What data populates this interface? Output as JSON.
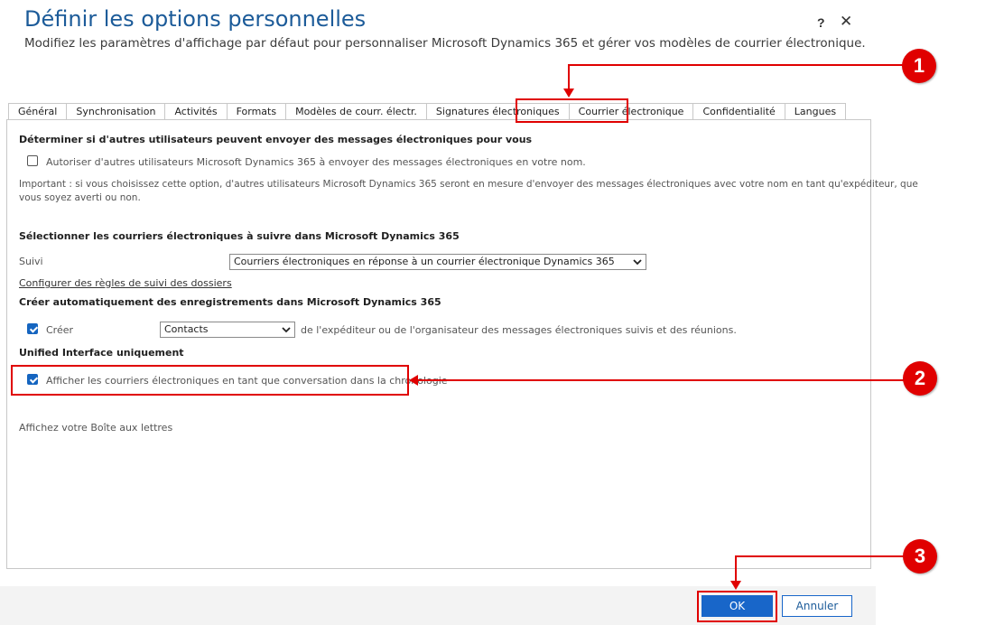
{
  "header": {
    "title": "Définir les options personnelles",
    "subtitle": "Modifiez les paramètres d'affichage par défaut pour personnaliser Microsoft Dynamics 365 et gérer vos modèles de courrier électronique.",
    "help": "?",
    "close": "✕"
  },
  "tabs": [
    {
      "label": "Général"
    },
    {
      "label": "Synchronisation"
    },
    {
      "label": "Activités"
    },
    {
      "label": "Formats"
    },
    {
      "label": "Modèles de courr. électr."
    },
    {
      "label": "Signatures électroniques"
    },
    {
      "label": "Courrier électronique",
      "active": true
    },
    {
      "label": "Confidentialité"
    },
    {
      "label": "Langues"
    }
  ],
  "email": {
    "section1_title": "Déterminer si d'autres utilisateurs peuvent envoyer des messages électroniques pour vous",
    "allow_others_label": "Autoriser d'autres utilisateurs Microsoft Dynamics 365 à envoyer des messages électroniques en votre nom.",
    "allow_others_checked": false,
    "important_line1": "Important : si vous choisissez cette option, d'autres utilisateurs Microsoft Dynamics 365 seront en mesure d'envoyer des messages électroniques avec votre nom en tant qu'expéditeur, que",
    "important_line2": "vous soyez averti ou non.",
    "section2_title": "Sélectionner les courriers électroniques à suivre dans Microsoft Dynamics 365",
    "track_label": "Suivi",
    "track_value": "Courriers électroniques en réponse à un courrier électronique Dynamics 365",
    "folder_rules_link": "Configurer des règles de suivi des dossiers",
    "section3_title": "Créer automatiquement des enregistrements dans Microsoft Dynamics 365",
    "create_label": "Créer",
    "create_checked": true,
    "create_value": "Contacts",
    "create_suffix": "de l'expéditeur ou de l'organisateur des messages électroniques suivis et des réunions.",
    "section4_title": "Unified Interface uniquement",
    "conversation_label": "Afficher les courriers électroniques en tant que conversation dans la chronologie",
    "conversation_checked": true,
    "mailbox_text": "Affichez votre Boîte aux lettres"
  },
  "footer": {
    "ok": "OK",
    "cancel": "Annuler"
  },
  "callouts": [
    "1",
    "2",
    "3"
  ],
  "colors": {
    "title": "#1c5b99",
    "primary": "#1866c9",
    "callout": "#e00000"
  },
  "icons": {
    "help": "question-mark-icon",
    "close": "close-icon",
    "dropdown": "chevron-down-icon",
    "checkbox": "checkmark-icon"
  }
}
